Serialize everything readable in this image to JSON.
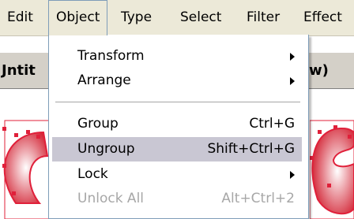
{
  "menubar": {
    "items": [
      {
        "label": "Edit"
      },
      {
        "label": "Object"
      },
      {
        "label": "Type"
      },
      {
        "label": "Select"
      },
      {
        "label": "Filter"
      },
      {
        "label": "Effect"
      }
    ]
  },
  "document": {
    "title_left": "Jntit",
    "title_right": "w)"
  },
  "object_menu": {
    "items": [
      {
        "label": "Transform",
        "shortcut": "",
        "submenu": true,
        "enabled": true
      },
      {
        "label": "Arrange",
        "shortcut": "",
        "submenu": true,
        "enabled": true
      },
      {
        "label": "Group",
        "shortcut": "Ctrl+G",
        "submenu": false,
        "enabled": true
      },
      {
        "label": "Ungroup",
        "shortcut": "Shift+Ctrl+G",
        "submenu": false,
        "enabled": true,
        "highlighted": true
      },
      {
        "label": "Lock",
        "shortcut": "",
        "submenu": true,
        "enabled": true
      },
      {
        "label": "Unlock All",
        "shortcut": "Alt+Ctrl+2",
        "submenu": false,
        "enabled": false
      }
    ]
  },
  "colors": {
    "menubar_bg": "#ece9d8",
    "highlight": "#c9c7d3",
    "disabled_text": "#a7a7a7",
    "art_red": "#d42a3a",
    "selection_red": "#e0203a"
  }
}
